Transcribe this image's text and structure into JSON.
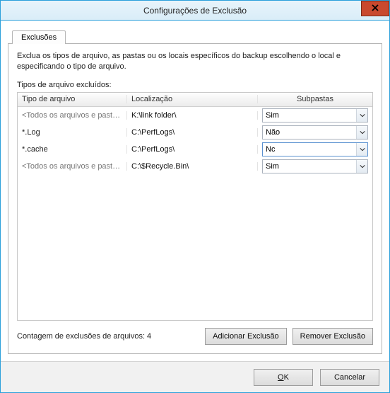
{
  "window": {
    "title": "Configurações de Exclusão",
    "close_icon": "close-icon"
  },
  "tabs": [
    {
      "label": "Exclusões"
    }
  ],
  "description": "Exclua os tipos de arquivo, as pastas ou os locais específicos do backup escolhendo o local e especificando o tipo de arquivo.",
  "list_heading": "Tipos de arquivo excluídos:",
  "columns": {
    "type": "Tipo de arquivo",
    "location": "Localização",
    "subfolders": "Subpastas"
  },
  "rows": [
    {
      "type": "<Todos os arquivos e pastas>",
      "all": true,
      "location": "K:\\link folder\\",
      "subfolders": "Sim",
      "open": false
    },
    {
      "type": "*.Log",
      "all": false,
      "location": "C:\\PerfLogs\\",
      "subfolders": "Não",
      "open": false
    },
    {
      "type": "*.cache",
      "all": false,
      "location": "C:\\PerfLogs\\",
      "subfolders": "Nc",
      "open": true
    },
    {
      "type": "<Todos os arquivos e pastas>",
      "all": true,
      "location": "C:\\$Recycle.Bin\\",
      "subfolders": "Sim",
      "open": false
    }
  ],
  "count_label": "Contagem de exclusões de arquivos: 4",
  "buttons": {
    "add": "Adicionar Exclusão",
    "remove": "Remover Exclusão",
    "ok_prefix": "O",
    "ok_suffix": "K",
    "cancel": "Cancelar"
  }
}
